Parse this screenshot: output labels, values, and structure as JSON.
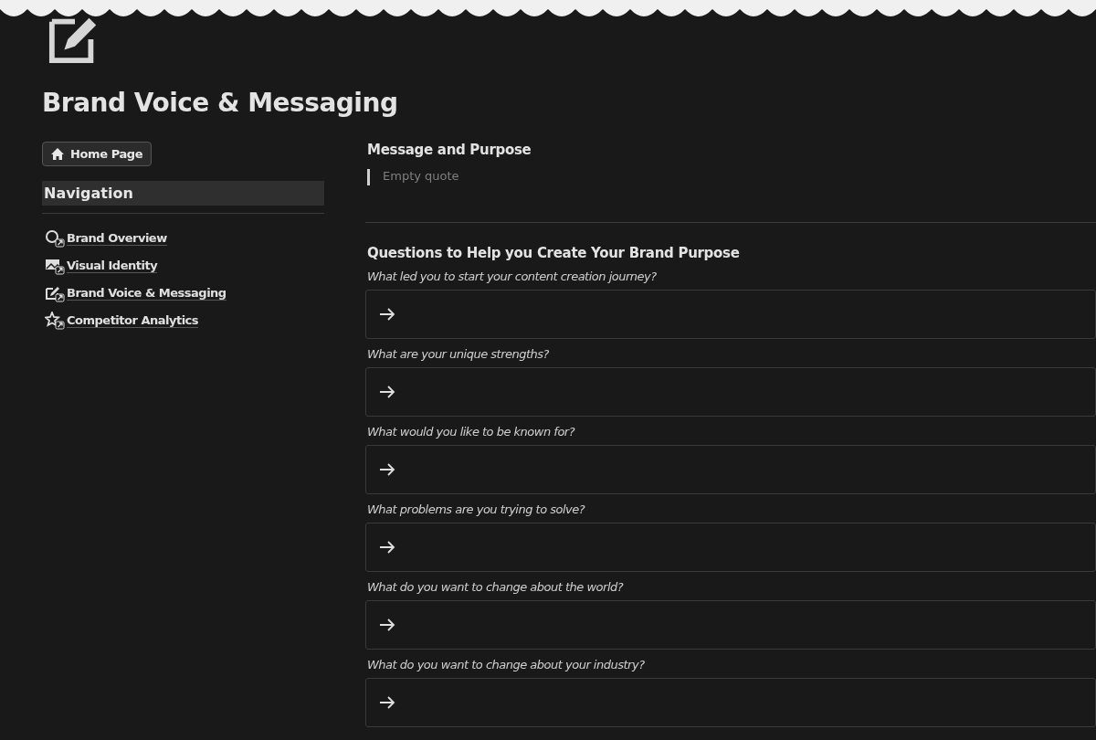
{
  "page": {
    "title": "Brand Voice & Messaging"
  },
  "home_button": {
    "label": "Home Page"
  },
  "navigation": {
    "heading": "Navigation",
    "items": [
      {
        "label": "Brand Overview",
        "kind": "search"
      },
      {
        "label": "Visual Identity",
        "kind": "image"
      },
      {
        "label": "Brand Voice & Messaging",
        "kind": "edit"
      },
      {
        "label": "Competitor Analytics",
        "kind": "star"
      }
    ]
  },
  "message_section": {
    "heading": "Message and Purpose",
    "quote_placeholder": "Empty quote"
  },
  "questions_section": {
    "heading": "Questions to Help you Create Your Brand Purpose",
    "questions": [
      {
        "question": "What led you to start your content creation journey?"
      },
      {
        "question": "What are your unique strengths?"
      },
      {
        "question": "What would you like to be known for?"
      },
      {
        "question": "What problems are you trying to solve?"
      },
      {
        "question": "What do you want to change about the world?"
      },
      {
        "question": "What do you want to change about your industry?"
      }
    ]
  }
}
